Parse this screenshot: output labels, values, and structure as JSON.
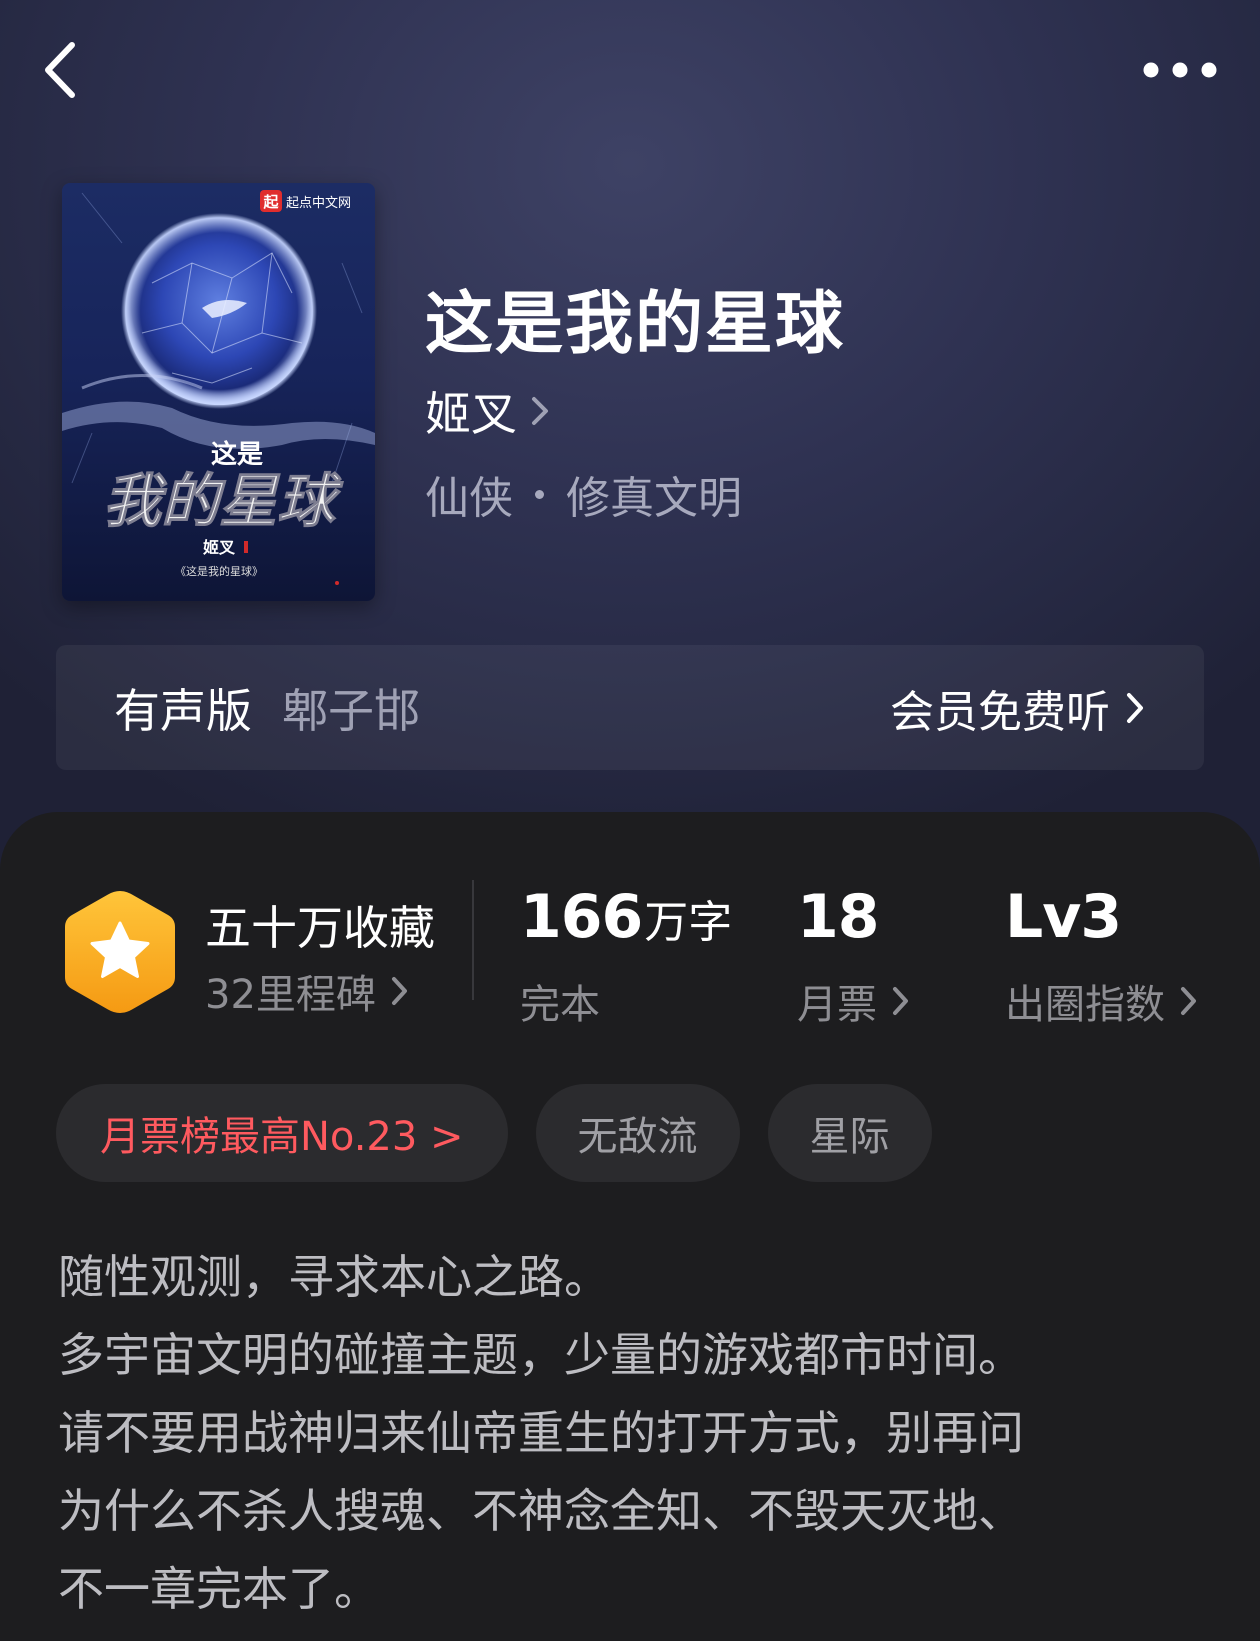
{
  "nav": {
    "back_icon": "chevron-left-icon",
    "more_icon": "more-horizontal-icon"
  },
  "book": {
    "title": "这是我的星球",
    "author": "姬叉",
    "genre_main": "仙侠",
    "genre_sub": "修真文明",
    "cover": {
      "publisher_badge": "起",
      "publisher_name": "起点中文网",
      "title_small": "这是",
      "title_large": "我的星球",
      "author": "姬叉",
      "subtitle": "《这是我的星球》"
    }
  },
  "audio": {
    "label": "有声版",
    "narrator": "郫子邯",
    "cta": "会员免费听"
  },
  "stats": {
    "collections": "五十万收藏",
    "milestones": "32里程碑",
    "word_count": "166",
    "word_unit": "万字",
    "status": "完本",
    "monthly_tickets": "18",
    "monthly_tickets_label": "月票",
    "level": "Lv3",
    "level_label": "出圈指数"
  },
  "tags": [
    "月票榜最高No.23 >",
    "无敌流",
    "星际"
  ],
  "description": [
    "随性观测，寻求本心之路。",
    "多宇宙文明的碰撞主题，少量的游戏都市时间。",
    "请不要用战神归来仙帝重生的打开方式，别再问",
    "为什么不杀人搜魂、不神念全知、不毁天灭地、",
    "不一章完本了。"
  ],
  "colors": {
    "header_bg": "#2f3252",
    "card_bg": "#1d1d1f",
    "tag_bg": "#2b2b2e",
    "rank_tag_text": "#ff5a5f",
    "badge_orange": "#f7a51c"
  }
}
